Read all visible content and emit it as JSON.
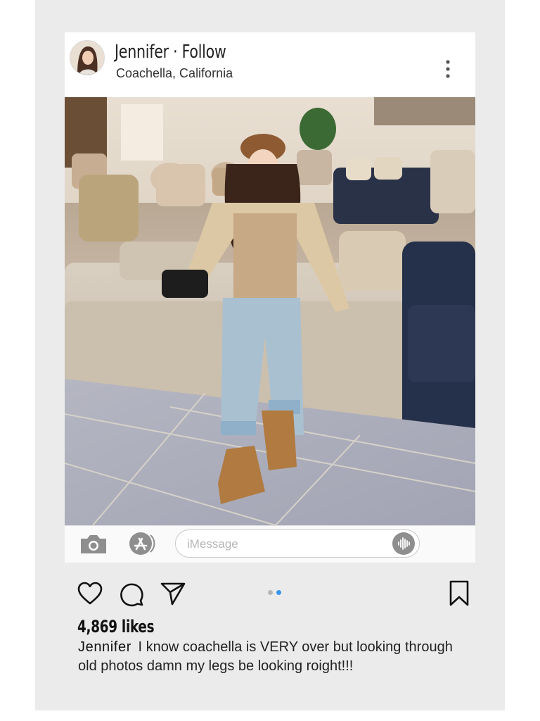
{
  "post": {
    "username": "Jennifer",
    "separator": " · ",
    "follow_label": "Follow",
    "location": "Coachella, California",
    "more_icon": "vertical-ellipsis-icon"
  },
  "imessage_bar": {
    "placeholder": "iMessage",
    "camera_icon": "camera-icon",
    "appstore_icon": "app-store-icon",
    "voice_icon": "voice-waveform-icon"
  },
  "actions": {
    "icons": [
      "heart-icon",
      "comment-icon",
      "share-icon",
      "bookmark-icon"
    ],
    "carousel": {
      "count": 2,
      "active": 1,
      "active_color": "#3897f0",
      "inactive_color": "#b6b6b6"
    }
  },
  "engagement": {
    "likes": "4,869 likes"
  },
  "caption": {
    "username": "Jennifer",
    "text": "I know coachella is VERY over but looking through old photos damn my legs be looking roight!!!"
  }
}
